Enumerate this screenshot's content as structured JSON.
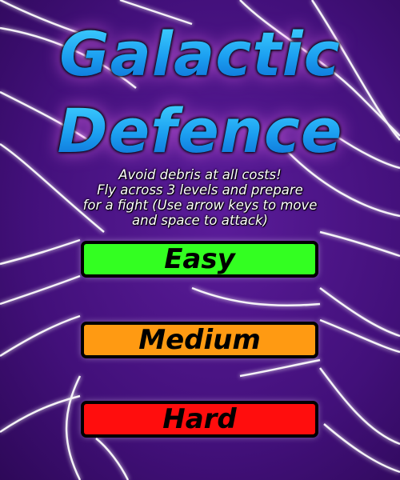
{
  "title": {
    "line1": "Galactic",
    "line2": "Defence"
  },
  "description": {
    "line1": "Avoid debris at all costs!",
    "line2": "Fly across 3 levels and prepare",
    "line3": "for a fight (Use arrow keys to move",
    "line4": "and space to attack)"
  },
  "buttons": {
    "easy": {
      "label": "Easy",
      "color": "#33ff21"
    },
    "medium": {
      "label": "Medium",
      "color": "#ff9a12"
    },
    "hard": {
      "label": "Hard",
      "color": "#ff0d0d"
    }
  },
  "colors": {
    "background": "#3d0f6e",
    "title": "#1aa6f0",
    "line_glow": "#ffffff"
  }
}
